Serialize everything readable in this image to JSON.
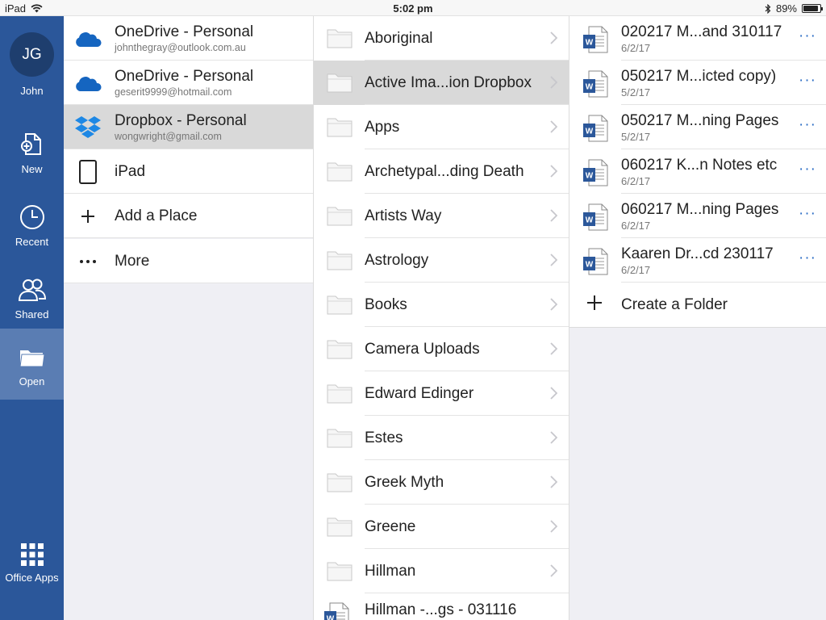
{
  "status": {
    "device": "iPad",
    "time": "5:02 pm",
    "battery": "89%",
    "battery_level": 0.89
  },
  "rail": {
    "initials": "JG",
    "user": "John",
    "items": [
      {
        "label": "New",
        "icon": "new-doc-icon"
      },
      {
        "label": "Recent",
        "icon": "clock-icon"
      },
      {
        "label": "Shared",
        "icon": "people-icon"
      },
      {
        "label": "Open",
        "icon": "folder-open-icon",
        "active": true
      }
    ],
    "office_apps": "Office Apps"
  },
  "places": [
    {
      "title": "OneDrive - Personal",
      "sub": "johnthegray@outlook.com.au",
      "icon": "onedrive-icon"
    },
    {
      "title": "OneDrive - Personal",
      "sub": "geserit9999@hotmail.com",
      "icon": "onedrive-icon"
    },
    {
      "title": "Dropbox - Personal",
      "sub": "wongwright@gmail.com",
      "icon": "dropbox-icon",
      "selected": true
    },
    {
      "title": "iPad",
      "icon": "ipad-icon"
    },
    {
      "title": "Add a Place",
      "icon": "plus-icon"
    },
    {
      "title": "More",
      "icon": "more-icon"
    }
  ],
  "folders": [
    "Aboriginal",
    "Active Ima...ion Dropbox",
    "Apps",
    "Archetypal...ding Death",
    "Artists Way",
    "Astrology",
    "Books",
    "Camera Uploads",
    "Edward Edinger",
    "Estes",
    "Greek Myth",
    "Greene",
    "Hillman"
  ],
  "folder_file": "Hillman -...gs - 031116",
  "files": [
    {
      "name": "020217 M...and 310117",
      "date": "6/2/17"
    },
    {
      "name": "050217 M...icted copy)",
      "date": "5/2/17"
    },
    {
      "name": "050217 M...ning Pages",
      "date": "5/2/17"
    },
    {
      "name": "060217 K...n Notes etc",
      "date": "6/2/17"
    },
    {
      "name": "060217 M...ning Pages",
      "date": "6/2/17"
    },
    {
      "name": "Kaaren Dr...cd 230117",
      "date": "6/2/17"
    }
  ],
  "create_folder": "Create a Folder",
  "more_glyph": "···",
  "word_letter": "W",
  "colors": {
    "rail": "#2b579a",
    "rail_active": "#5a7db3",
    "accent": "#2b6cc4",
    "selected": "#d9d9d9"
  }
}
